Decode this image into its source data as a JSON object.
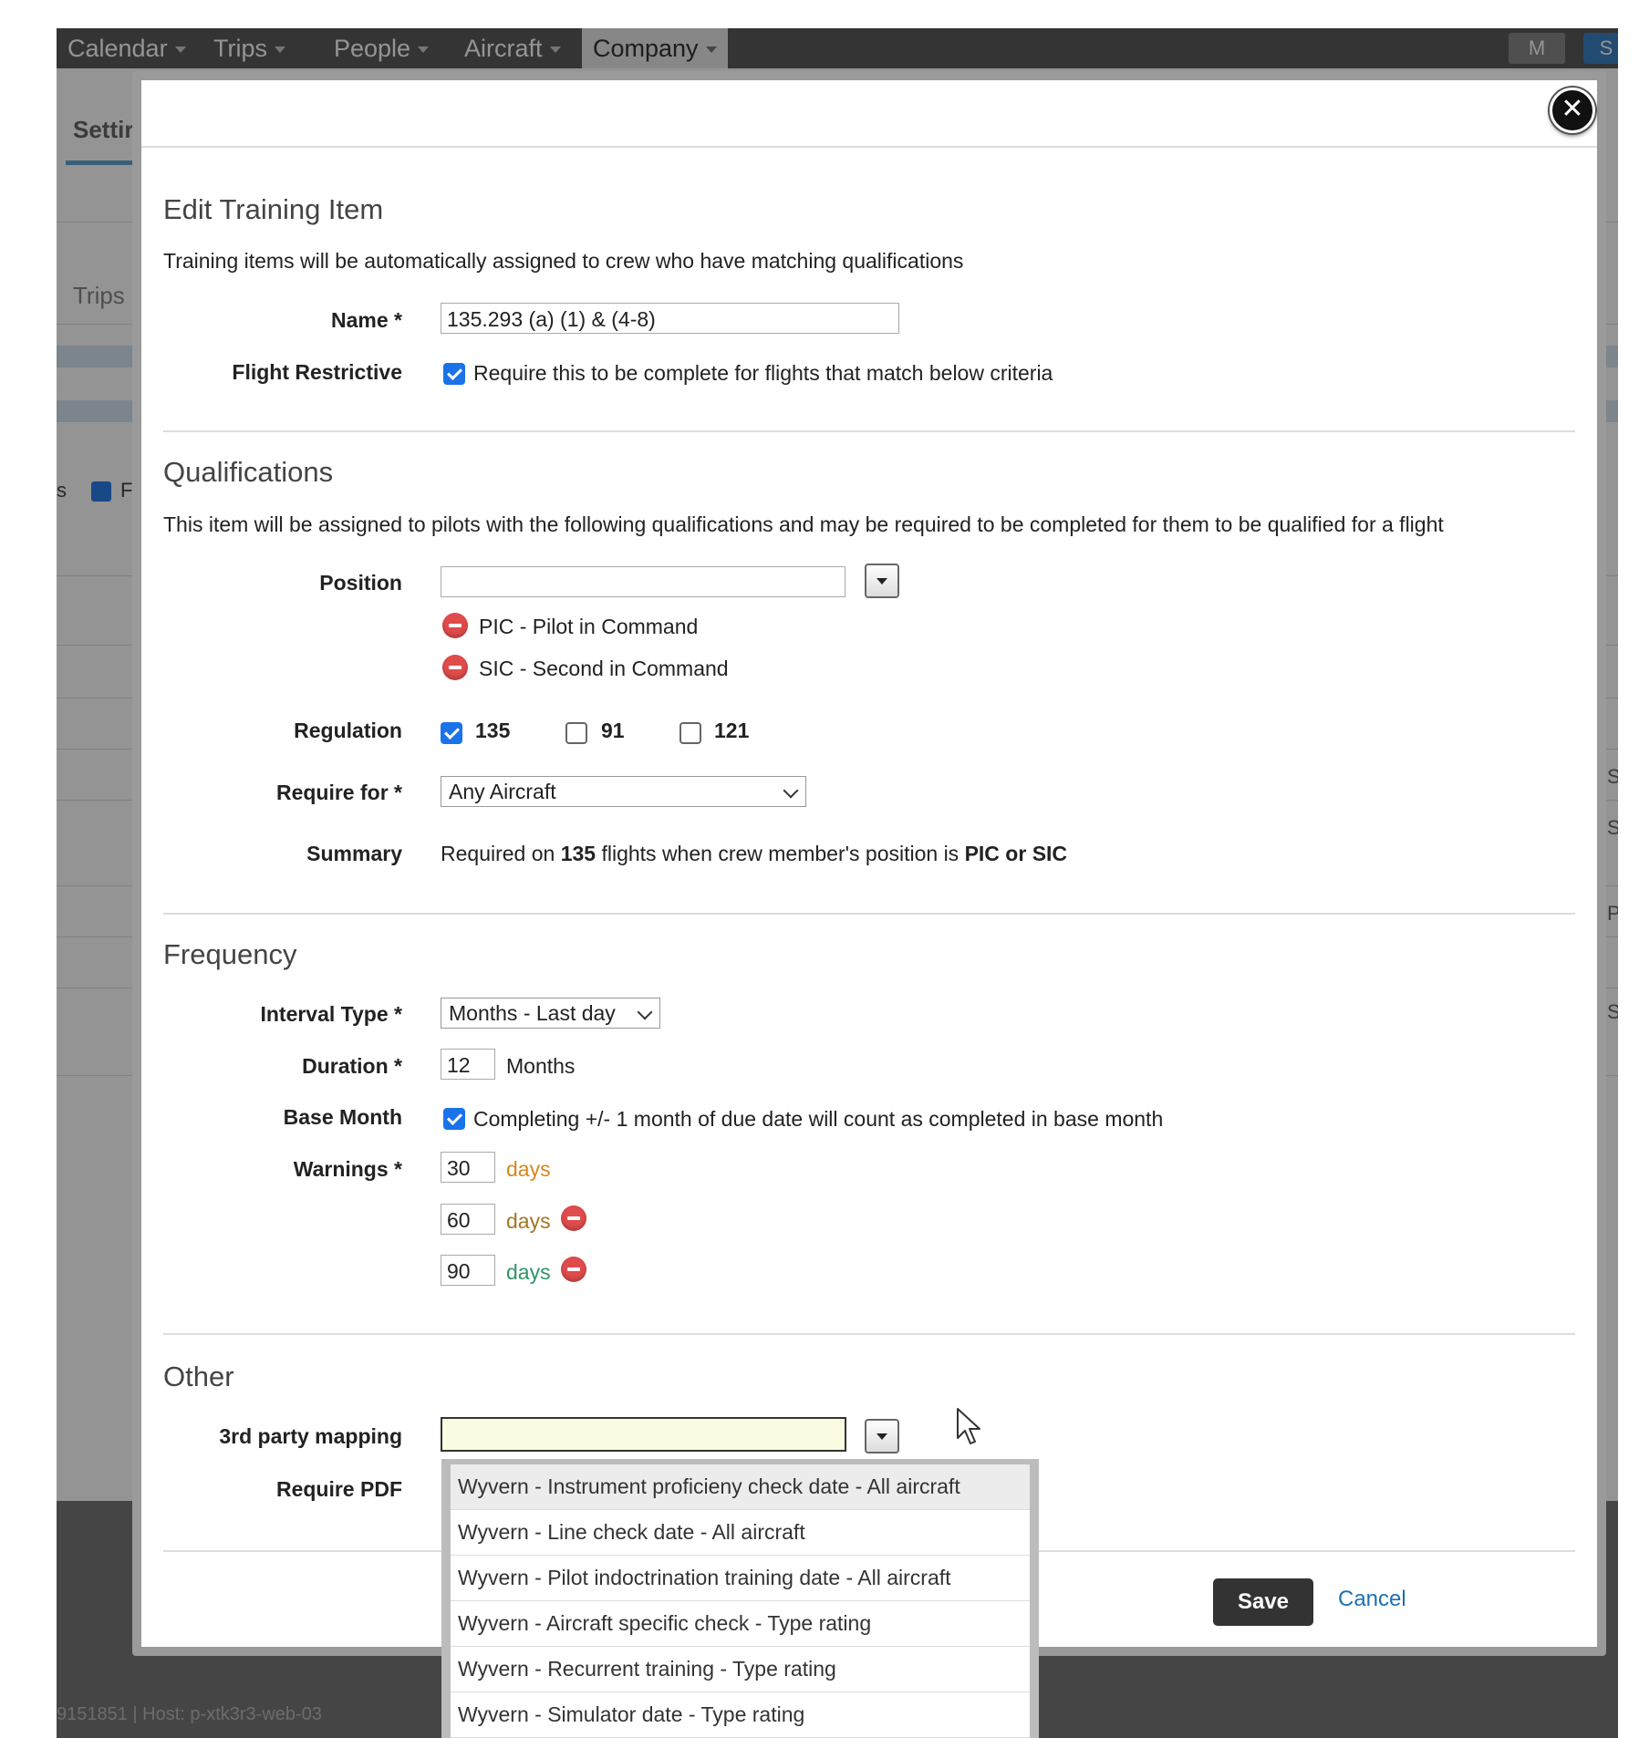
{
  "nav": {
    "items": [
      {
        "label": "Calendar"
      },
      {
        "label": "Trips"
      },
      {
        "label": "People"
      },
      {
        "label": "Aircraft"
      },
      {
        "label": "Company"
      }
    ],
    "avatars": [
      "M",
      "S"
    ]
  },
  "background": {
    "tab": "Settir",
    "sub": "Trips",
    "check_label_left": "s",
    "check_label_right": "F",
    "right_letters": [
      "S",
      "S",
      "PI",
      "S"
    ],
    "footer_text": "9151851  |  Host: p-xtk3r3-web-03"
  },
  "modal": {
    "close_label": "✕",
    "edit": {
      "title": "Edit Training Item",
      "description": "Training items will be automatically assigned to crew who have matching qualifications",
      "name_label": "Name *",
      "name_value": "135.293 (a) (1) & (4-8)",
      "flight_restrictive_label": "Flight Restrictive",
      "flight_restrictive_checked": true,
      "flight_restrictive_text": "Require this to be complete for flights that match below criteria"
    },
    "qualifications": {
      "title": "Qualifications",
      "description": "This item will be assigned to pilots with the following qualifications and may be required to be completed for them to be qualified for a flight",
      "position_label": "Position",
      "position_value": "",
      "positions": [
        "PIC - Pilot in Command",
        "SIC - Second in Command"
      ],
      "regulation_label": "Regulation",
      "regulations": [
        {
          "label": "135",
          "checked": true
        },
        {
          "label": "91",
          "checked": false
        },
        {
          "label": "121",
          "checked": false
        }
      ],
      "require_for_label": "Require for *",
      "require_for_value": "Any Aircraft",
      "summary_label": "Summary",
      "summary_pre": "Required on ",
      "summary_reg": "135",
      "summary_mid": " flights when crew member's position is ",
      "summary_pos": "PIC or SIC"
    },
    "frequency": {
      "title": "Frequency",
      "interval_type_label": "Interval Type *",
      "interval_type_value": "Months - Last day",
      "duration_label": "Duration *",
      "duration_value": "12",
      "duration_unit": "Months",
      "base_month_label": "Base Month",
      "base_month_checked": true,
      "base_month_text": "Completing +/- 1 month of due date will count as completed in base month",
      "warnings_label": "Warnings *",
      "warnings": [
        {
          "value": "30",
          "unit": "days",
          "color": "#d9861c"
        },
        {
          "value": "60",
          "unit": "days",
          "color": "#a27721"
        },
        {
          "value": "90",
          "unit": "days",
          "color": "#2f9467"
        }
      ]
    },
    "other": {
      "title": "Other",
      "mapping_label": "3rd party mapping",
      "mapping_value": "",
      "require_pdf_label": "Require PDF",
      "mapping_options": [
        "Wyvern - Instrument proficieny check date - All aircraft",
        "Wyvern - Line check date - All aircraft",
        "Wyvern - Pilot indoctrination training date - All aircraft",
        "Wyvern - Aircraft specific check - Type rating",
        "Wyvern - Recurrent training - Type rating",
        "Wyvern - Simulator date - Type rating"
      ],
      "highlighted_option_index": 0
    },
    "footer": {
      "save_label": "Save",
      "cancel_label": "Cancel"
    }
  }
}
